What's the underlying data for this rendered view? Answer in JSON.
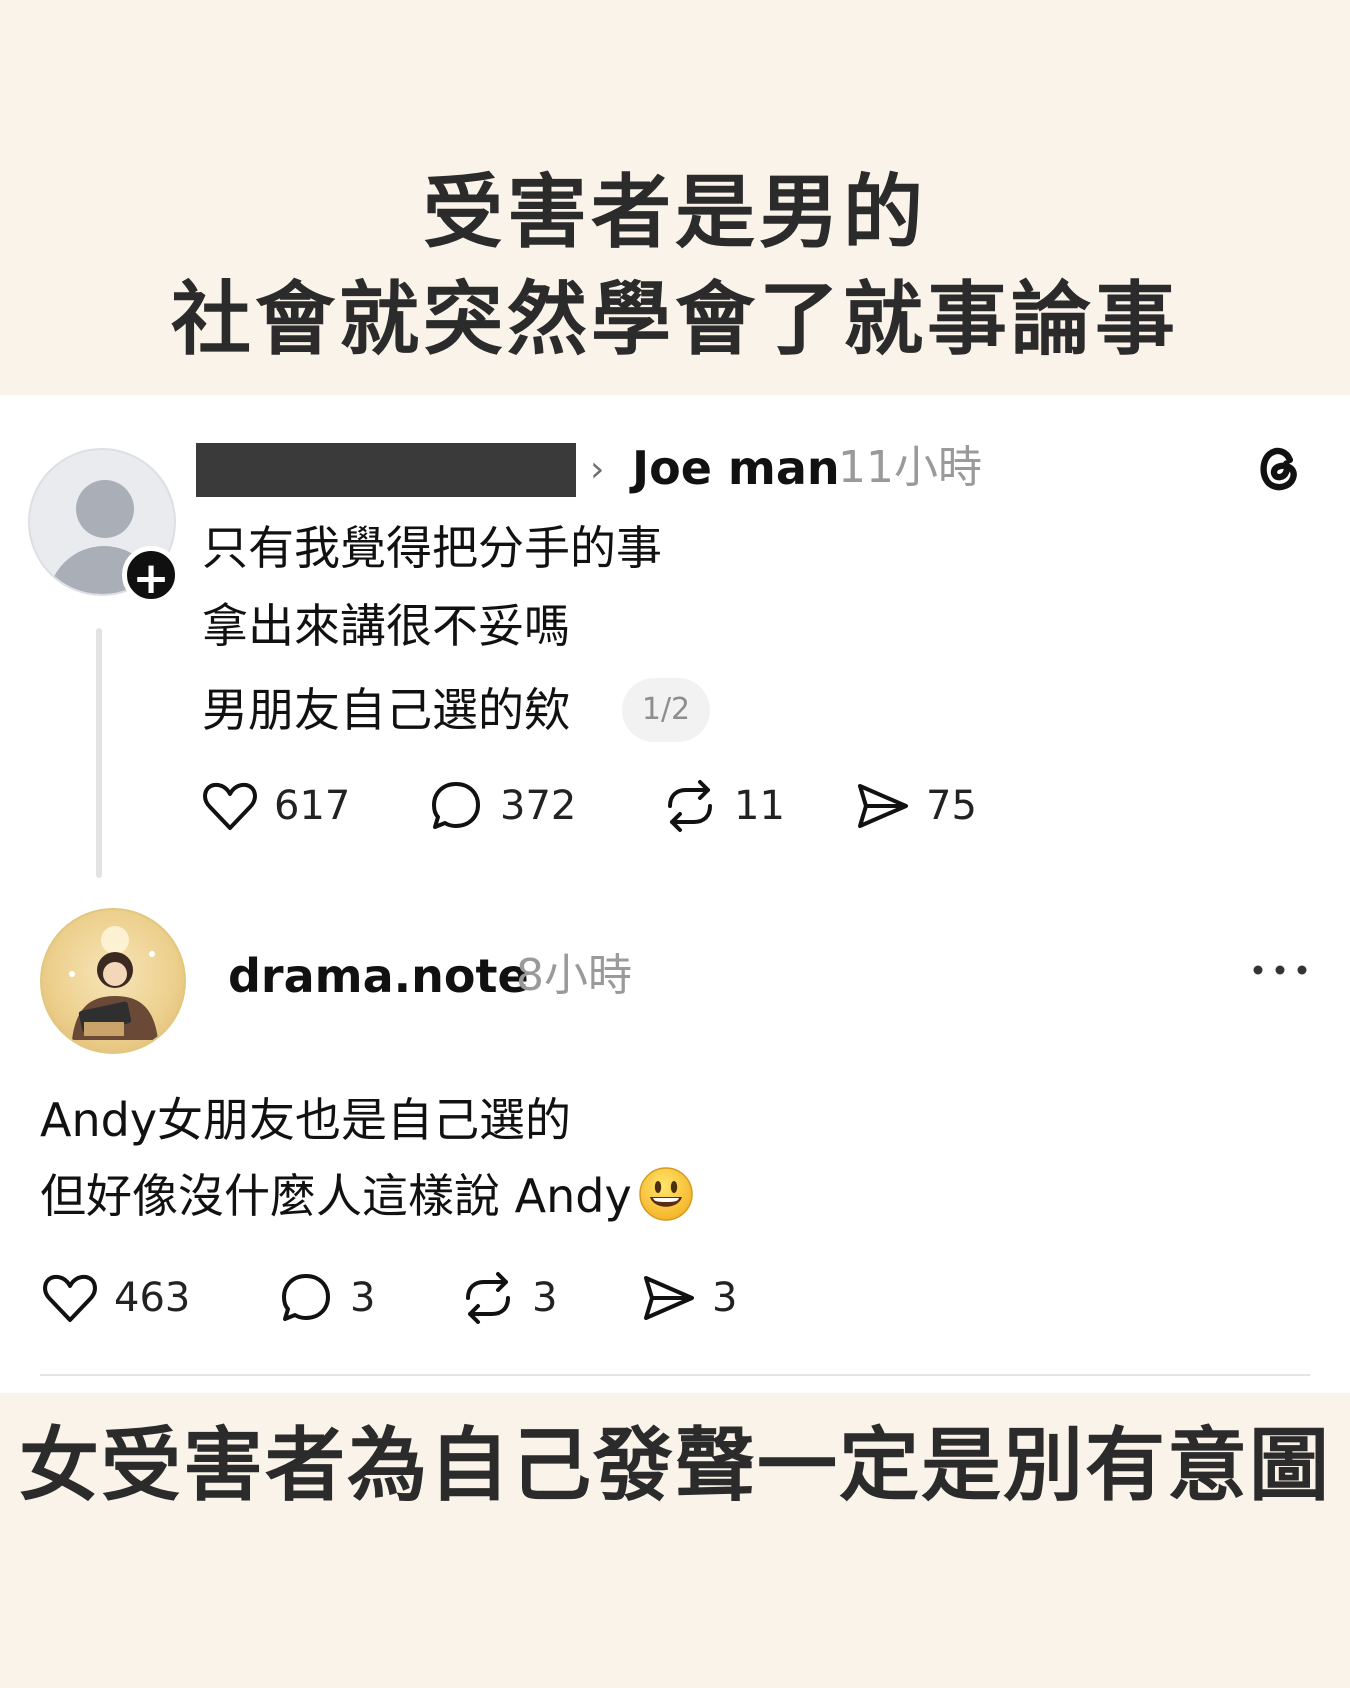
{
  "headline": {
    "top_line_1": "受害者是男的",
    "top_line_2": "社會就突然學會了就事論事",
    "bottom": "女受害者為自己發聲一定是別有意圖"
  },
  "original_post": {
    "username": "Joe man",
    "time": "11小時",
    "lines": [
      "只有我覺得把分手的事",
      "拿出來講很不妥嗎",
      "男朋友自己選的欸"
    ],
    "page_badge": "1/2",
    "stats": {
      "likes": "617",
      "replies": "372",
      "reposts": "11",
      "shares": "75"
    }
  },
  "reply_post": {
    "username": "drama.note",
    "time": "8小時",
    "lines": [
      "Andy女朋友也是自己選的",
      "但好像沒什麼人這樣說 Andy"
    ],
    "stats": {
      "likes": "463",
      "replies": "3",
      "reposts": "3",
      "shares": "3"
    }
  },
  "icons": {
    "logo": "threads-logo-icon",
    "more": "more-horizontal-icon",
    "like": "heart-icon",
    "reply": "comment-bubble-icon",
    "repost": "repost-icon",
    "share": "send-icon",
    "emoji": "smiley-emoji-icon"
  }
}
